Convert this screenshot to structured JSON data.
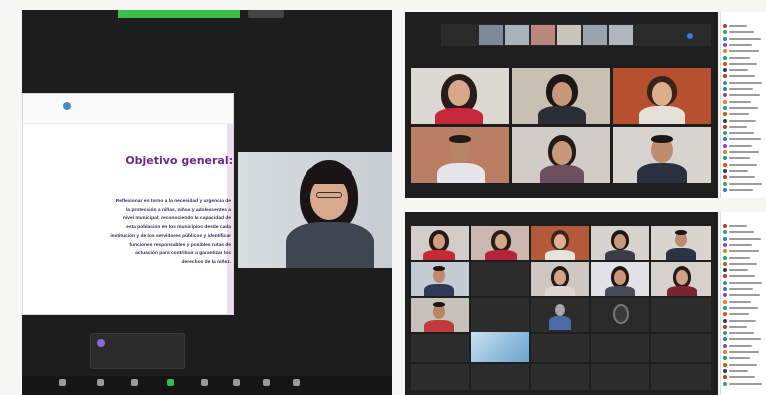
{
  "app": {
    "accent": "#3cbf4a",
    "background": "#1d1d1d"
  },
  "presentation": {
    "logos": [
      "",
      "",
      ""
    ],
    "title": "Objetivo general:",
    "body_lines": [
      "Reflexionar en torno a la necesidad y urgencia de",
      "la protección a niñas, niños y adolescentes a",
      "nivel municipal; reconociendo la capacidad de",
      "esta población en los municipios desde cada",
      "institución y de los servidores públicos y identificar",
      "funciones responsables y posibles rutas de",
      "actuación para contribuir a garantizar los",
      "derechos de la niñez."
    ]
  },
  "chat_popup": {
    "text": "",
    "sub": ""
  },
  "toolbar": {
    "buttons": [
      {
        "icon": "mic-icon",
        "label": ""
      },
      {
        "icon": "participants-icon",
        "label": ""
      },
      {
        "icon": "chat-icon",
        "label": ""
      },
      {
        "icon": "share-screen-icon",
        "label": ""
      },
      {
        "icon": "record-icon",
        "label": ""
      },
      {
        "icon": "reactions-icon",
        "label": ""
      },
      {
        "icon": "apps-icon",
        "label": ""
      },
      {
        "icon": "more-icon",
        "label": ""
      }
    ]
  },
  "gallery_top": {
    "strip_labels": [
      "",
      ""
    ]
  },
  "gallery_bottom": {
    "name_tiles": [
      "",
      "",
      "",
      "",
      "",
      "",
      "",
      "",
      "",
      "",
      "",
      "",
      ""
    ]
  },
  "participant_list": {
    "header": ""
  },
  "colors": {
    "participant_dots": [
      "#c0392b",
      "#27ae60",
      "#2980b9",
      "#8e44ad",
      "#e67e22",
      "#16a085",
      "#d35400",
      "#2c3e50",
      "#c0392b",
      "#27ae60",
      "#2980b9",
      "#8e44ad",
      "#e67e22",
      "#16a085",
      "#d35400",
      "#2c3e50",
      "#c0392b",
      "#27ae60",
      "#2980b9",
      "#8e44ad",
      "#e67e22",
      "#16a085",
      "#d35400",
      "#2c3e50",
      "#c0392b",
      "#27ae60",
      "#2980b9",
      "#8e44ad"
    ]
  }
}
